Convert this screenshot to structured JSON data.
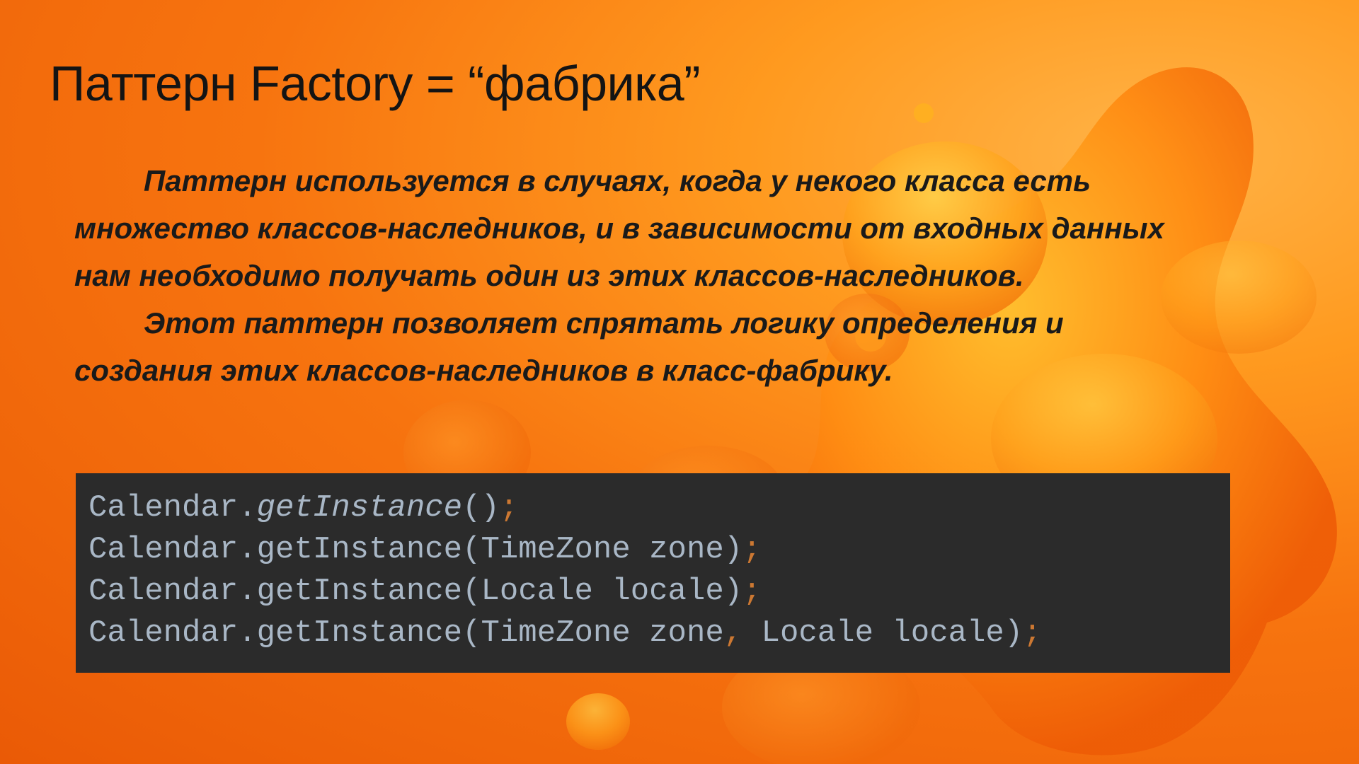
{
  "slide": {
    "title": "Паттерн Factory = “фабрика”",
    "paragraphs": [
      "Паттерн используется в случаях, когда у некого класса есть множество классов-наследников, и в зависимости от входных данных нам необходимо получать один из этих классов-наследников.",
      "Этот паттерн позволяет спрятать логику определения и создания этих классов-наследников в класс-фабрику."
    ],
    "code": {
      "line1": {
        "prefix": "Calendar.",
        "method": "getInstance",
        "args": "()",
        "semicolon": ";"
      },
      "line2": {
        "text": "Calendar.getInstance(TimeZone zone)",
        "semicolon": ";"
      },
      "line3": {
        "text": "Calendar.getInstance(Locale locale)",
        "semicolon": ";"
      },
      "line4": {
        "part1": "Calendar.getInstance(TimeZone zone",
        "comma": ",",
        "part2": " Locale locale)",
        "semicolon": ";"
      }
    }
  },
  "theme": {
    "background_colors": [
      "#ea5a06",
      "#f7740f",
      "#ff9a1f",
      "#ffb347"
    ],
    "code_background": "#2b2b2b",
    "code_text_color": "#a9b7c6",
    "code_punctuation_color": "#cc7832",
    "text_color": "#1a1a1a"
  }
}
